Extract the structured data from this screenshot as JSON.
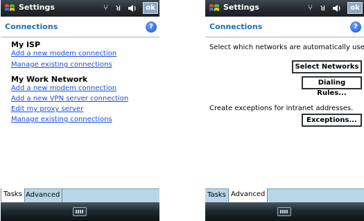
{
  "left": {
    "titlebar": {
      "title": "Settings",
      "status_icons": "⚲ ▾ ◀ ",
      "ok": "ok"
    },
    "header": {
      "title": "Connections",
      "help": "?"
    },
    "sections": [
      {
        "heading": "My ISP",
        "links": [
          "Add a new modem connection",
          "Manage existing connections"
        ]
      },
      {
        "heading": "My Work Network",
        "links": [
          "Add a new modem connection",
          "Add a new VPN server connection",
          "Edit my proxy server",
          "Manage existing connections"
        ]
      }
    ],
    "tabs": [
      "Tasks",
      "Advanced"
    ],
    "active_tab": "Tasks"
  },
  "right": {
    "titlebar": {
      "title": "Settings",
      "ok": "ok"
    },
    "header": {
      "title": "Connections",
      "help": "?"
    },
    "text1": "Select which networks are automatically used.",
    "buttons": {
      "select_networks": "Select Networks",
      "dialing_rules": "Dialing Rules...",
      "exceptions": "Exceptions..."
    },
    "text2": "Create exceptions for intranet addresses.",
    "tabs": [
      "Tasks",
      "Advanced"
    ],
    "active_tab": "Advanced"
  },
  "colors": {
    "accent": "#1e6fb0",
    "link": "#1a4fe0",
    "tabbar": "#b9d6e8"
  }
}
